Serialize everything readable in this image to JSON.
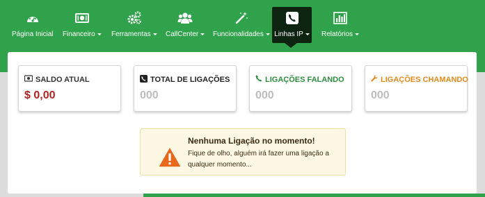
{
  "nav": {
    "items": [
      {
        "label": "Página Inicial",
        "icon": "dashboard-icon",
        "dropdown": false
      },
      {
        "label": "Financeiro",
        "icon": "money-icon",
        "dropdown": true
      },
      {
        "label": "Ferramentas",
        "icon": "cogs-icon",
        "dropdown": true
      },
      {
        "label": "CallCenter",
        "icon": "users-icon",
        "dropdown": true
      },
      {
        "label": "Funcionalidades",
        "icon": "magic-wand-icon",
        "dropdown": true
      },
      {
        "label": "Linhas IP",
        "icon": "phone-icon",
        "dropdown": true,
        "active": true
      },
      {
        "label": "Relatórios",
        "icon": "bar-chart-icon",
        "dropdown": true
      }
    ]
  },
  "cards": [
    {
      "title": "SALDO ATUAL",
      "value": "$ 0,00",
      "icon": "money-icon",
      "title_color": "#333333",
      "value_color": "#b22222"
    },
    {
      "title": "TOTAL DE LIGAÇÕES",
      "value": "000",
      "icon": "phone-square-icon",
      "title_color": "#222222",
      "value_color": "#bdbdbd"
    },
    {
      "title": "LIGAÇÕES FALANDO",
      "value": "000",
      "icon": "phone-icon",
      "title_color": "#2e8b3e",
      "value_color": "#bdbdbd"
    },
    {
      "title": "LIGAÇÕES CHAMANDO",
      "value": "000",
      "icon": "wrench-icon",
      "title_color": "#e08a1e",
      "value_color": "#bdbdbd"
    }
  ],
  "alert": {
    "title": "Nenhuma Ligação no momento!",
    "text": "Fique de olho, alguém irá fazer uma ligação a qualquer momento...",
    "icon": "warning-icon"
  },
  "colors": {
    "navbar": "#31a24c",
    "active_tab": "#0c2410",
    "alert_bg": "#fcf8e3"
  }
}
